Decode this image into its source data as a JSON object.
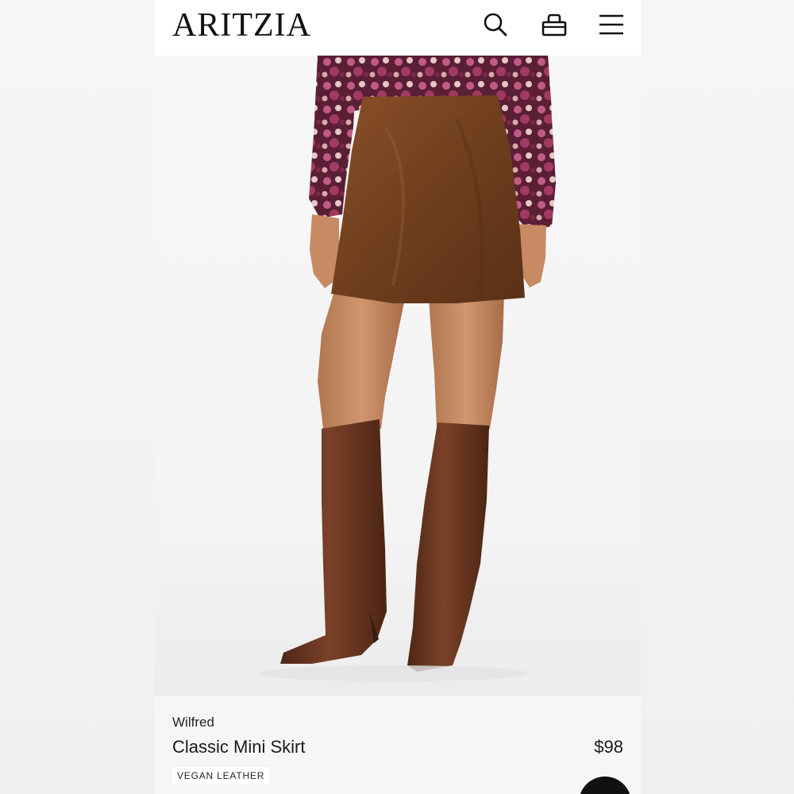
{
  "header": {
    "brand": "ARITZIA",
    "icons": [
      "search-icon",
      "shopping-bag-icon",
      "hamburger-menu-icon"
    ]
  },
  "product": {
    "brand": "Wilfred",
    "name": "Classic Mini Skirt",
    "price": "$98",
    "badge": "VEGAN LEATHER"
  },
  "colors": {
    "skirt": "#7a4522",
    "boots": "#6b3a22",
    "background": "#f3f3f3"
  }
}
